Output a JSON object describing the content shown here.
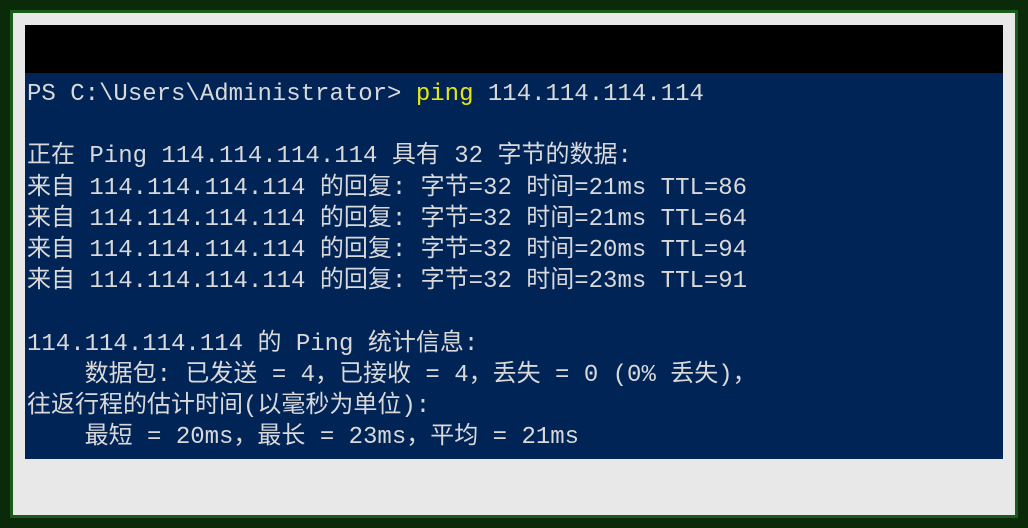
{
  "terminal": {
    "prompt_prefix": "PS C:\\Users\\Administrator> ",
    "command_name": "ping",
    "command_arg": " 114.114.114.114",
    "blank1": "",
    "ping_header": "正在 Ping 114.114.114.114 具有 32 字节的数据:",
    "reply1": "来自 114.114.114.114 的回复: 字节=32 时间=21ms TTL=86",
    "reply2": "来自 114.114.114.114 的回复: 字节=32 时间=21ms TTL=64",
    "reply3": "来自 114.114.114.114 的回复: 字节=32 时间=20ms TTL=94",
    "reply4": "来自 114.114.114.114 的回复: 字节=32 时间=23ms TTL=91",
    "blank2": "",
    "stats_header": "114.114.114.114 的 Ping 统计信息:",
    "stats_packets": "    数据包: 已发送 = 4，已接收 = 4，丢失 = 0 (0% 丢失)，",
    "rtt_header": "往返行程的估计时间(以毫秒为单位):",
    "rtt_values": "    最短 = 20ms，最长 = 23ms，平均 = 21ms"
  }
}
